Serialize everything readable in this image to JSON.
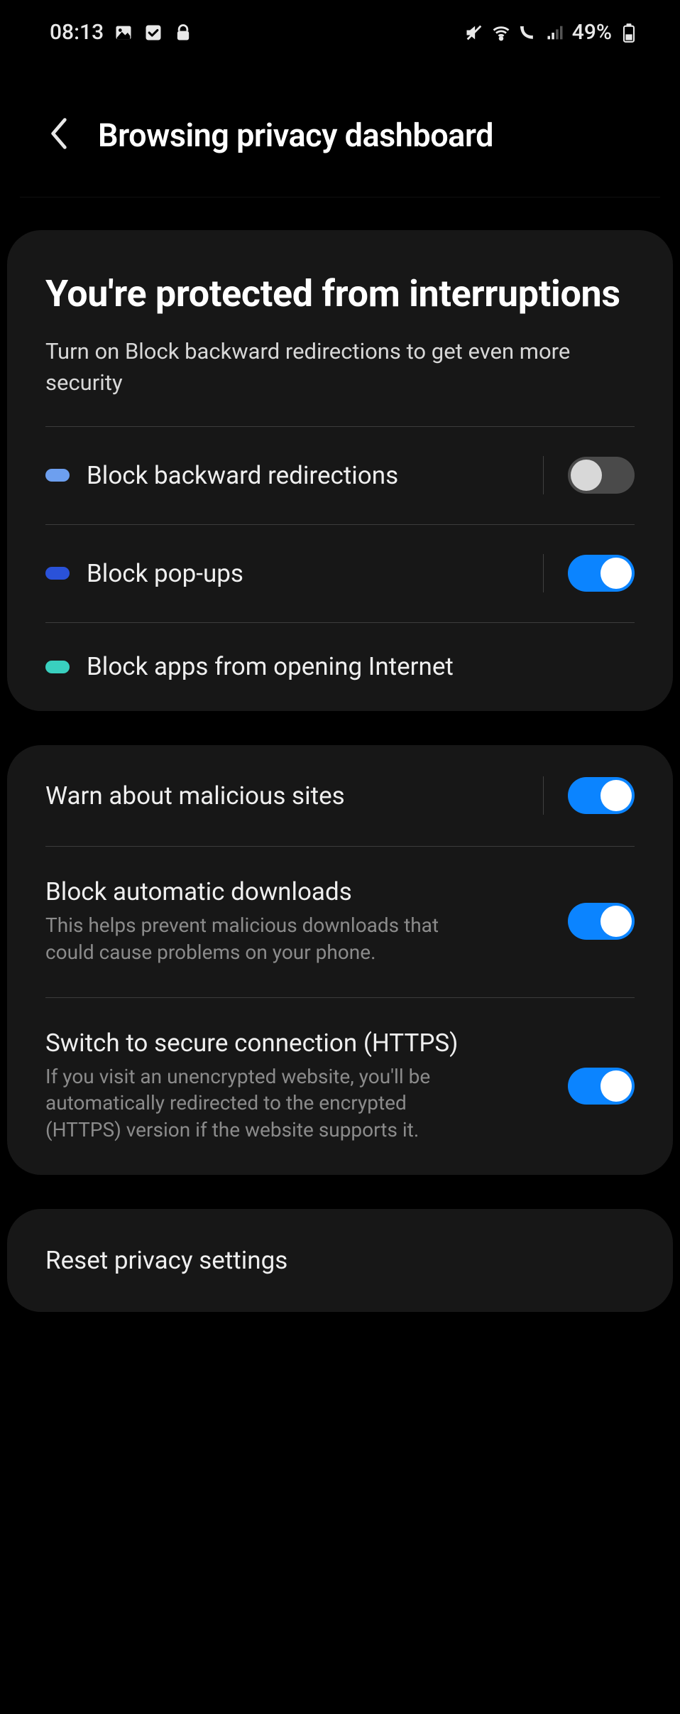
{
  "status": {
    "time": "08:13",
    "battery": "49%"
  },
  "header": {
    "title": "Browsing privacy dashboard"
  },
  "card1": {
    "title": "You're protected from interruptions",
    "subtitle": "Turn on Block backward redirections to get even more security",
    "items": [
      {
        "label": "Block backward redirections",
        "toggle": "off",
        "pill": "lightblue"
      },
      {
        "label": "Block pop-ups",
        "toggle": "on",
        "pill": "blue"
      },
      {
        "label": "Block apps from opening Internet",
        "pill": "teal"
      }
    ]
  },
  "card2": {
    "items": [
      {
        "label": "Warn about malicious sites",
        "toggle": "on"
      },
      {
        "label": "Block automatic downloads",
        "desc": "This helps prevent malicious downloads that could cause problems on your phone.",
        "toggle": "on"
      },
      {
        "label": "Switch to secure connection (HTTPS)",
        "desc": "If you visit an unencrypted website, you'll be automatically redirected to the encrypted (HTTPS) version if the website supports it.",
        "toggle": "on"
      }
    ]
  },
  "card3": {
    "label": "Reset privacy settings"
  }
}
